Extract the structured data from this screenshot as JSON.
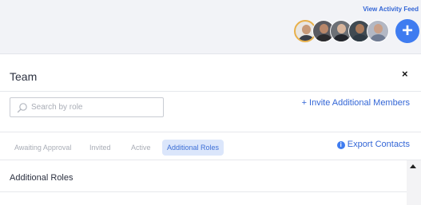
{
  "header": {
    "activity_feed_label": "View Activity Feed",
    "add_label": "+"
  },
  "avatars": [
    {
      "name": "team-member-avatar-1",
      "skin": "#c89a78",
      "shirt": "#3a3f48",
      "bg": "#e9e6e2"
    },
    {
      "name": "team-member-avatar-2",
      "skin": "#b9876a",
      "shirt": "#2b2b2e",
      "bg": "#5a5a60"
    },
    {
      "name": "team-member-avatar-3",
      "skin": "#d8b59c",
      "shirt": "#23262d",
      "bg": "#6c7076"
    },
    {
      "name": "team-member-avatar-4",
      "skin": "#a97a5b",
      "shirt": "#2e3a44",
      "bg": "#404a52"
    },
    {
      "name": "team-member-avatar-5",
      "skin": "#c9a089",
      "shirt": "#6f7b92",
      "bg": "#b3b8c4"
    }
  ],
  "panel": {
    "title": "Team",
    "close_label": "×",
    "search_placeholder": "Search by role",
    "invite_label": "+ Invite Additional Members",
    "export_label": "Export Contacts",
    "info_glyph": "i",
    "tabs": [
      {
        "label": "Awaiting Approval",
        "active": false
      },
      {
        "label": "Invited",
        "active": false
      },
      {
        "label": "Active",
        "active": false
      },
      {
        "label": "Additional Roles",
        "active": true
      }
    ],
    "section_title": "Additional Roles"
  },
  "colors": {
    "accent": "#3f7cf0",
    "link": "#3366d6",
    "active_tab_bg": "#dbe6fb",
    "avatar_highlight": "#e8b04a"
  }
}
